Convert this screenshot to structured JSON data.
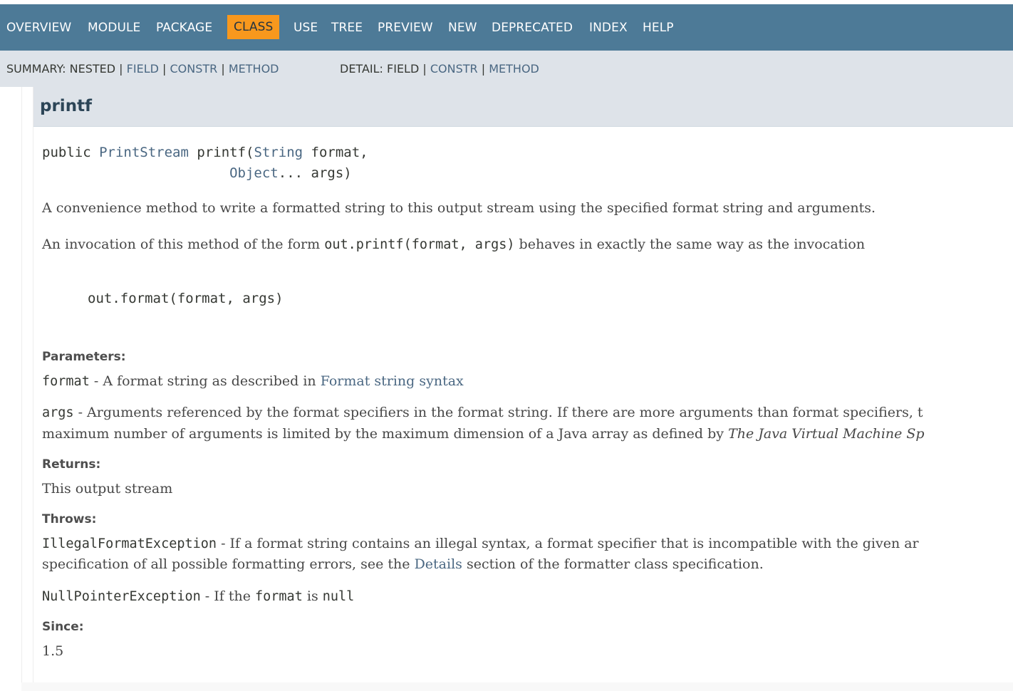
{
  "nav": {
    "items": [
      {
        "label": "OVERVIEW",
        "active": false
      },
      {
        "label": "MODULE",
        "active": false
      },
      {
        "label": "PACKAGE",
        "active": false
      },
      {
        "label": "CLASS",
        "active": true
      },
      {
        "label": "USE",
        "active": false
      },
      {
        "label": "TREE",
        "active": false
      },
      {
        "label": "PREVIEW",
        "active": false
      },
      {
        "label": "NEW",
        "active": false
      },
      {
        "label": "DEPRECATED",
        "active": false
      },
      {
        "label": "INDEX",
        "active": false
      },
      {
        "label": "HELP",
        "active": false
      }
    ]
  },
  "subnav": {
    "summary_prefix": "SUMMARY: NESTED",
    "summary_links": [
      "FIELD",
      "CONSTR",
      "METHOD"
    ],
    "detail_prefix": "DETAIL: FIELD",
    "detail_links": [
      "CONSTR",
      "METHOD"
    ],
    "separator": "|"
  },
  "member": {
    "title": "printf",
    "signature": {
      "modifier": "public",
      "return_type": "PrintStream",
      "name": "printf(",
      "param1_type": "String",
      "param1_name": " format,",
      "param2_type": "Object",
      "param2_name": "... args)"
    },
    "description1": "A convenience method to write a formatted string to this output stream using the specified format string and arguments.",
    "description2_before": "An invocation of this method of the form ",
    "description2_code": "out.printf(format, args)",
    "description2_after": " behaves in exactly the same way as the invocation",
    "code_example": "out.format(format, args)",
    "parameters_label": "Parameters:",
    "param_format_name": "format",
    "param_format_desc": " - A format string as described in ",
    "param_format_link": "Format string syntax",
    "param_args_name": "args",
    "param_args_desc": " - Arguments referenced by the format specifiers in the format string. If there are more arguments than format specifiers, t",
    "param_args_desc2_before": "maximum number of arguments is limited by the maximum dimension of a Java array as defined by ",
    "param_args_desc2_italic": "The Java Virtual Machine Sp",
    "returns_label": "Returns:",
    "returns_desc": "This output stream",
    "throws_label": "Throws:",
    "throws1_name": "IllegalFormatException",
    "throws1_desc": " - If a format string contains an illegal syntax, a format specifier that is incompatible with the given ar",
    "throws1_desc2_before": "specification of all possible formatting errors, see the ",
    "throws1_desc2_link": "Details",
    "throws1_desc2_after": " section of the formatter class specification.",
    "throws2_name": "NullPointerException",
    "throws2_desc_before": " - If the ",
    "throws2_code1": "format",
    "throws2_desc_mid": " is ",
    "throws2_code2": "null",
    "since_label": "Since:",
    "since_value": "1.5"
  }
}
